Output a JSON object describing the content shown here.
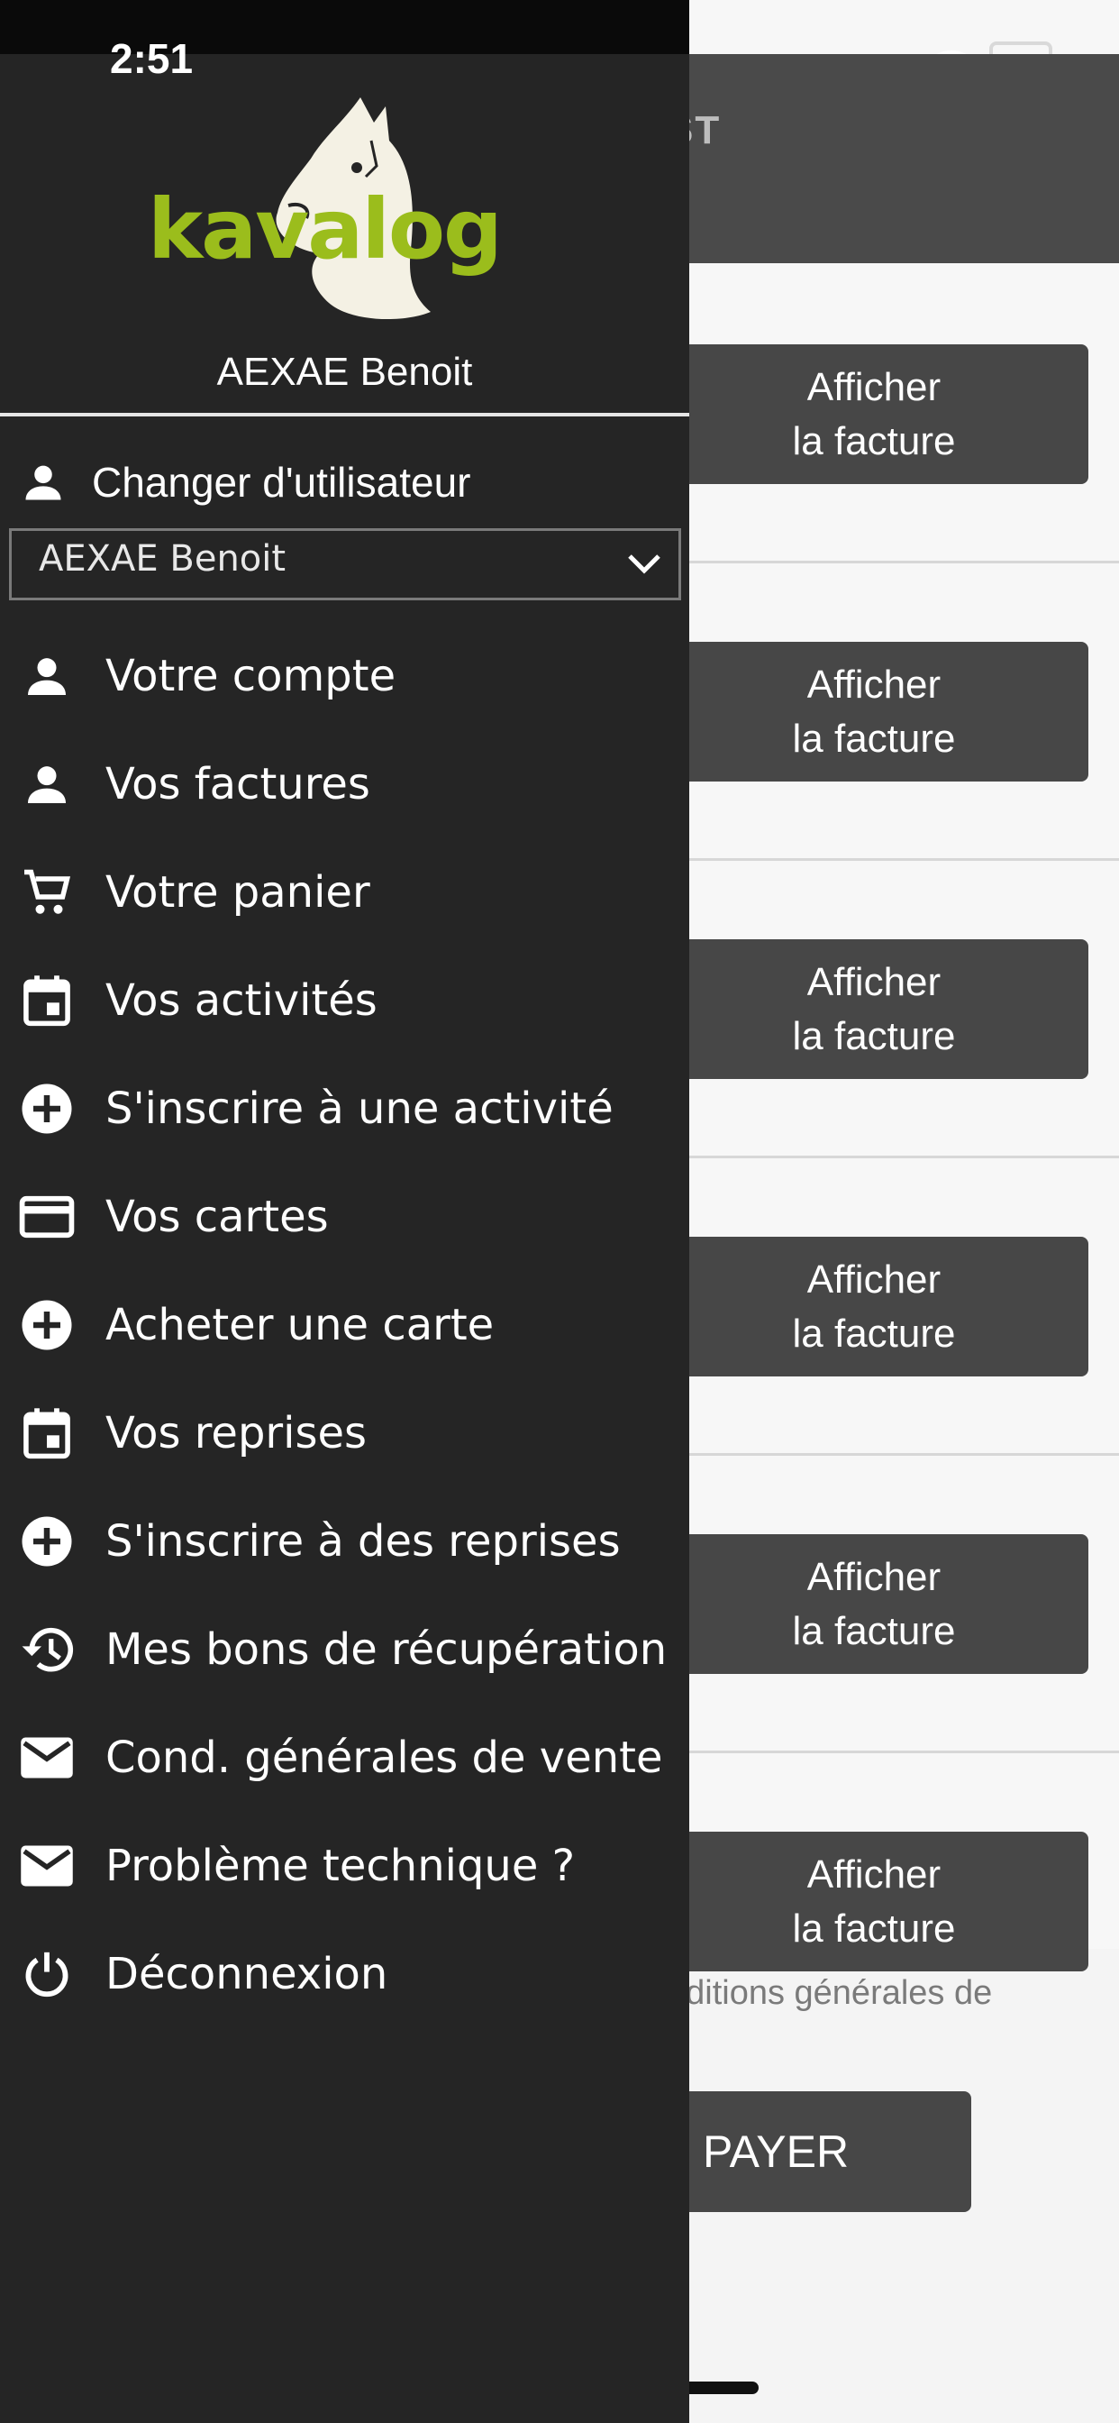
{
  "status_bar": {
    "time": "2:51"
  },
  "app": {
    "header_title": "ST",
    "invoice_button_line1": "Afficher",
    "invoice_button_line2": "la facture",
    "invoices": [
      {
        "btn1": "Afficher",
        "btn2": "la facture"
      },
      {
        "btn1": "Afficher",
        "btn2": "la facture"
      },
      {
        "btn1": "Afficher",
        "btn2": "la facture"
      },
      {
        "btn1": "Afficher",
        "btn2": "la facture"
      },
      {
        "btn1": "Afficher",
        "btn2": "la facture"
      },
      {
        "btn1": "Afficher",
        "btn2": "la facture"
      }
    ],
    "terms_text": "nditions générales de",
    "pay_label": "PAYER"
  },
  "drawer": {
    "logo_text": "kavalog",
    "user_name": "AEXAE Benoit",
    "switch_user_label": "Changer d'utilisateur",
    "selected_user": "AEXAE Benoit",
    "menu": [
      {
        "label": "Votre compte",
        "icon": "person-icon"
      },
      {
        "label": "Vos factures",
        "icon": "person-icon"
      },
      {
        "label": "Votre panier",
        "icon": "cart-icon"
      },
      {
        "label": "Vos activités",
        "icon": "calendar-icon"
      },
      {
        "label": "S'inscrire à une activité",
        "icon": "add-circle-icon"
      },
      {
        "label": "Vos cartes",
        "icon": "credit-card-icon"
      },
      {
        "label": "Acheter une carte",
        "icon": "add-circle-icon"
      },
      {
        "label": "Vos reprises",
        "icon": "calendar-icon"
      },
      {
        "label": "S'inscrire à des reprises",
        "icon": "add-circle-icon"
      },
      {
        "label": "Mes bons de récupération",
        "icon": "history-icon"
      },
      {
        "label": "Cond. générales de vente",
        "icon": "mail-icon"
      },
      {
        "label": "Problème technique ?",
        "icon": "mail-icon"
      },
      {
        "label": "Déconnexion",
        "icon": "power-icon"
      }
    ]
  },
  "colors": {
    "drawer_bg": "#252525",
    "logo_green": "#9bbd1c",
    "button_bg": "#474747"
  }
}
